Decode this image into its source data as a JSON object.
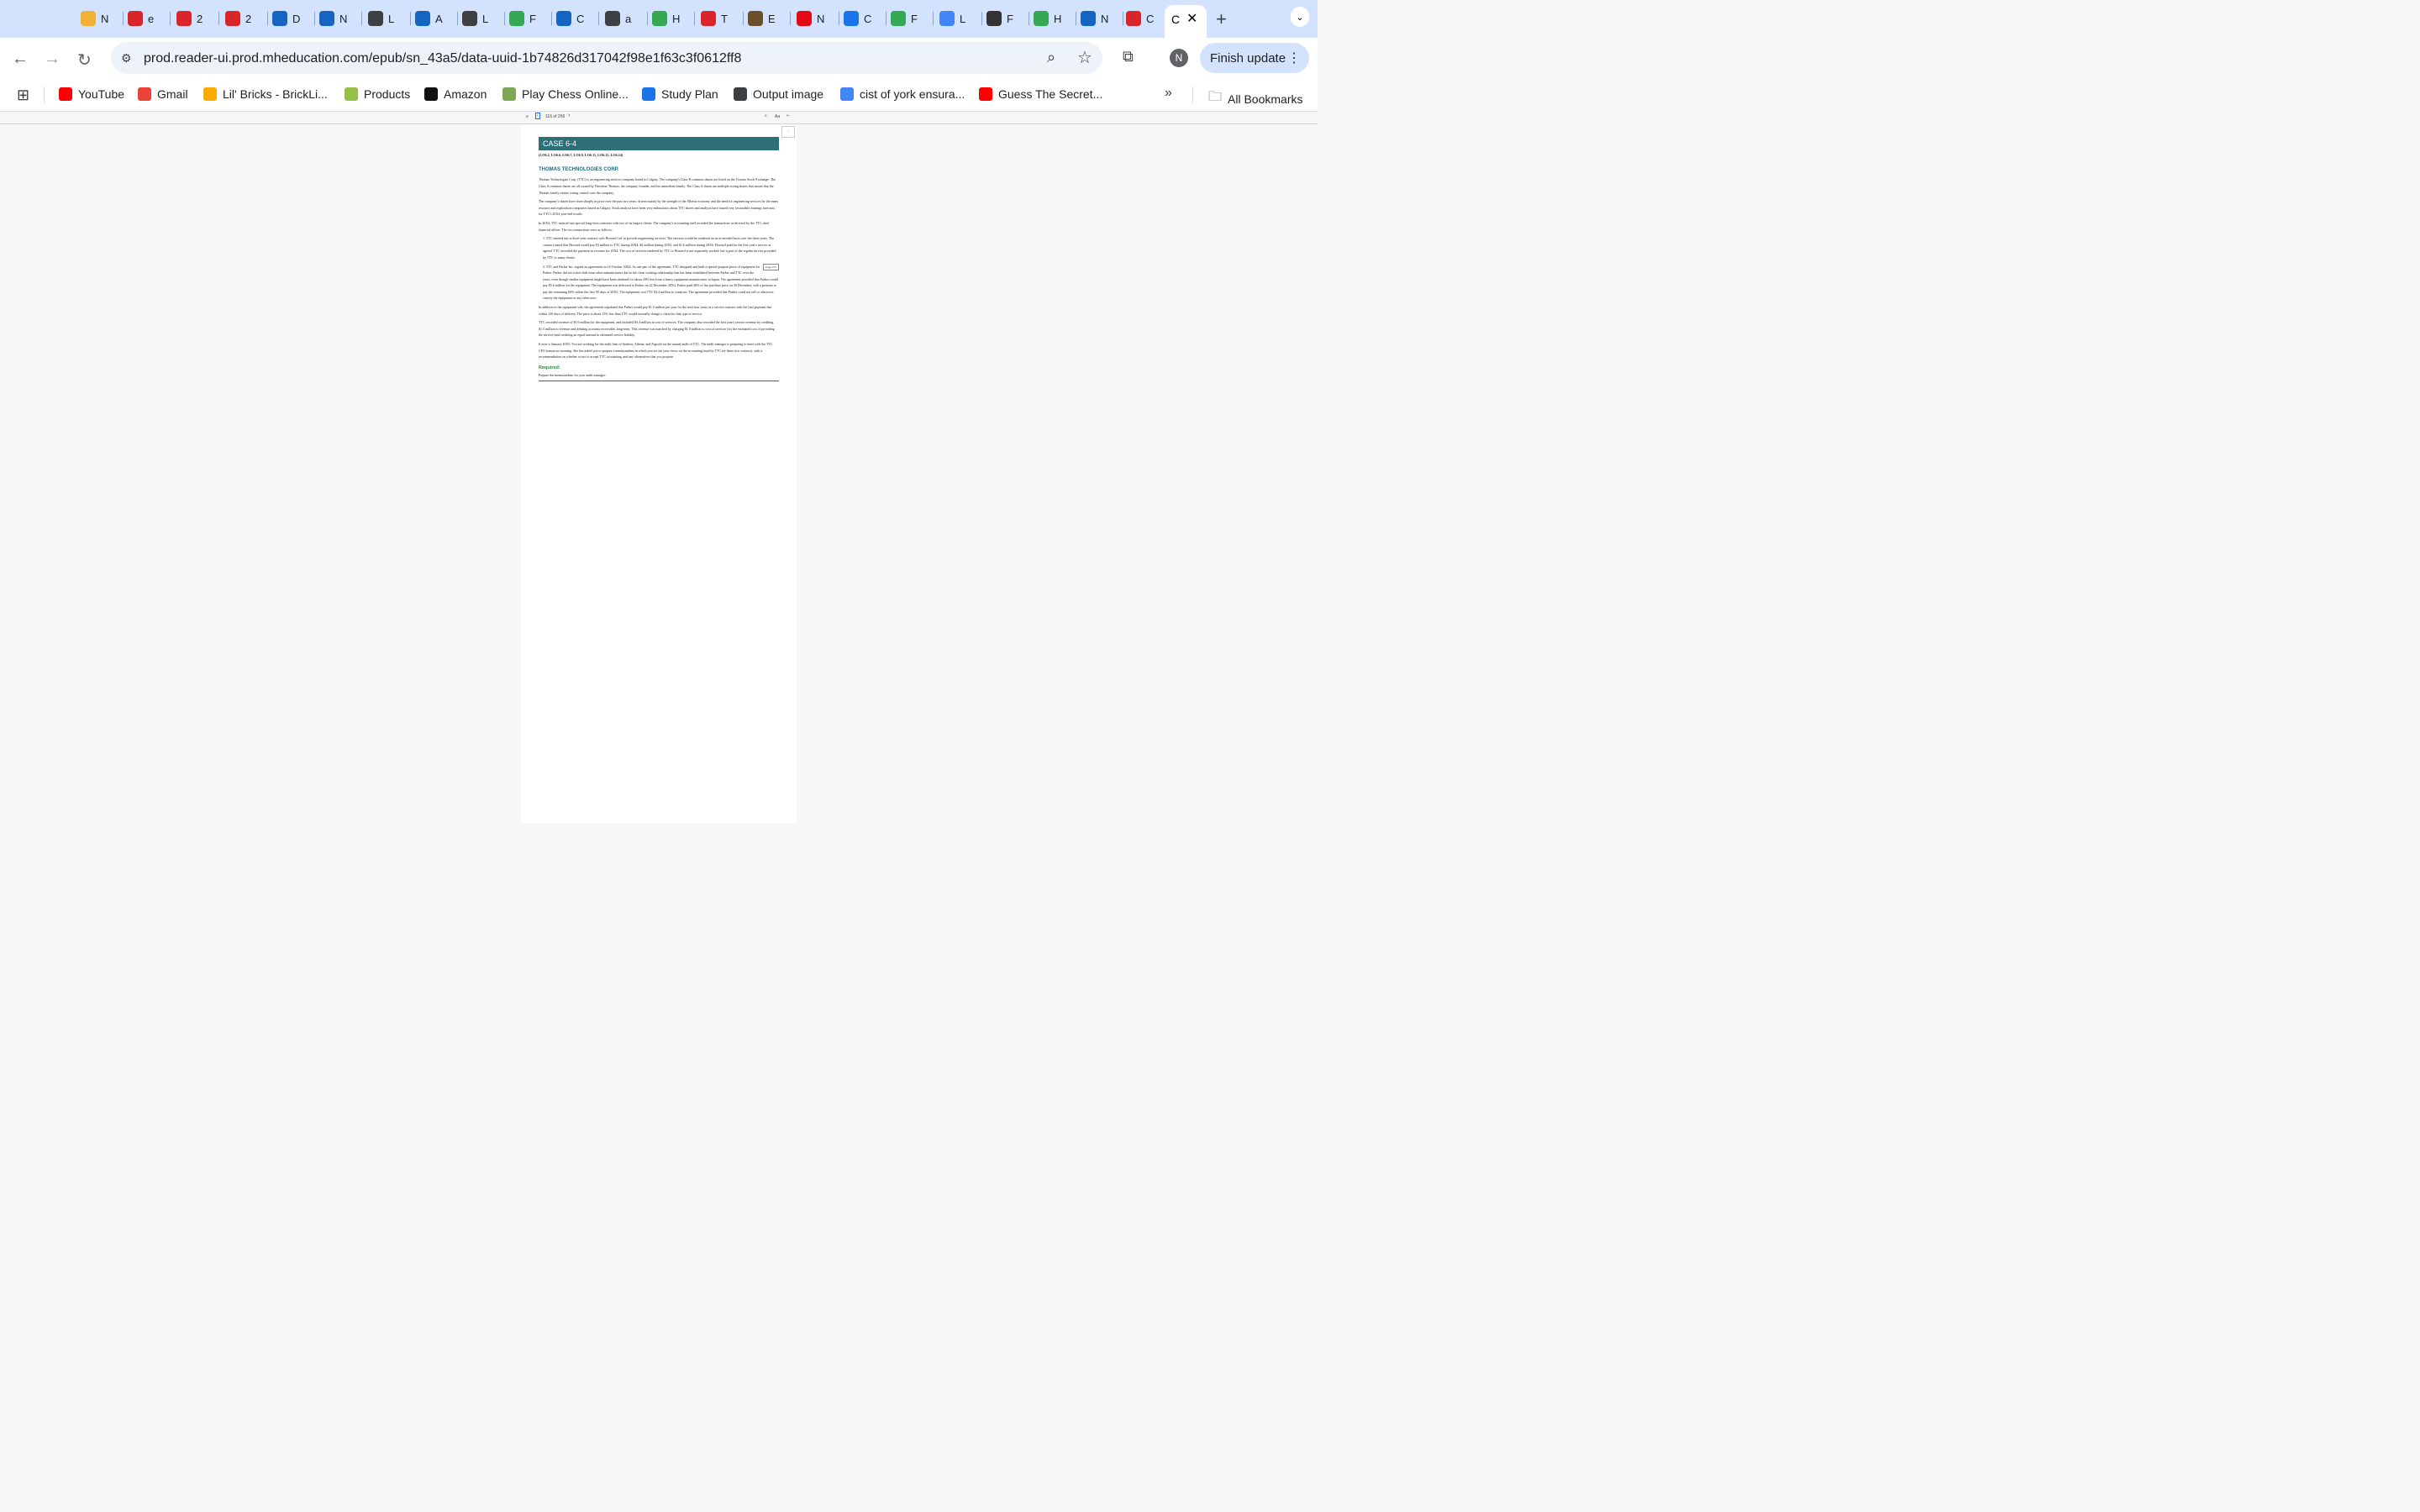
{
  "tabs": [
    {
      "fav": "chart",
      "color": "#f2b134",
      "letter": "N"
    },
    {
      "fav": "u",
      "color": "#d9252a",
      "letter": "e"
    },
    {
      "fav": "u",
      "color": "#d9252a",
      "letter": "2"
    },
    {
      "fav": "u",
      "color": "#d9252a",
      "letter": "2"
    },
    {
      "fav": "s",
      "color": "#1565c0",
      "letter": "D"
    },
    {
      "fav": "s",
      "color": "#1565c0",
      "letter": "N"
    },
    {
      "fav": "globe",
      "color": "#3c4043",
      "letter": "L"
    },
    {
      "fav": "s",
      "color": "#1565c0",
      "letter": "A"
    },
    {
      "fav": "globe",
      "color": "#3c4043",
      "letter": "L"
    },
    {
      "fav": "drive",
      "color": "#34a853",
      "letter": "F"
    },
    {
      "fav": "s",
      "color": "#1565c0",
      "letter": "C"
    },
    {
      "fav": "globe",
      "color": "#3c4043",
      "letter": "a"
    },
    {
      "fav": "drive",
      "color": "#34a853",
      "letter": "H"
    },
    {
      "fav": "mc",
      "color": "#d9252a",
      "letter": "T"
    },
    {
      "fav": "img",
      "color": "#6b4f2a",
      "letter": "E"
    },
    {
      "fav": "n",
      "color": "#e50914",
      "letter": "N"
    },
    {
      "fav": "atp",
      "color": "#1a73e8",
      "letter": "C"
    },
    {
      "fav": "drive",
      "color": "#34a853",
      "letter": "F"
    },
    {
      "fav": "doc",
      "color": "#4285f4",
      "letter": "L"
    },
    {
      "fav": "ai",
      "color": "#333333",
      "letter": "F"
    },
    {
      "fav": "drive",
      "color": "#34a853",
      "letter": "H"
    },
    {
      "fav": "s",
      "color": "#1565c0",
      "letter": "N"
    },
    {
      "fav": "mc",
      "color": "#d9252a",
      "letter": "C"
    }
  ],
  "active_tab_letter": "C",
  "url": "prod.reader-ui.prod.mheducation.com/epub/sn_43a5/data-uuid-1b74826d317042f98e1f63c3f0612ff8",
  "avatar_letter": "N",
  "finish_update": "Finish update",
  "bookmarks": [
    {
      "label": "YouTube",
      "icon": "youtube",
      "color": "#ff0000"
    },
    {
      "label": "Gmail",
      "icon": "gmail",
      "color": "#ea4335"
    },
    {
      "label": "Lil' Bricks - BrickLi...",
      "icon": "bricks",
      "color": "#f9ab00"
    },
    {
      "label": "Products",
      "icon": "shopify",
      "color": "#95bf47"
    },
    {
      "label": "Amazon",
      "icon": "amazon",
      "color": "#111111"
    },
    {
      "label": "Play Chess Online...",
      "icon": "chess",
      "color": "#7fa650"
    },
    {
      "label": "Study Plan",
      "icon": "p",
      "color": "#1a73e8"
    },
    {
      "label": "Output image",
      "icon": "globe",
      "color": "#3c4043"
    },
    {
      "label": "cist of york ensura...",
      "icon": "google",
      "color": "#4285f4"
    },
    {
      "label": "Guess The Secret...",
      "icon": "youtube",
      "color": "#ff0000"
    }
  ],
  "all_bookmarks": "All Bookmarks",
  "reader": {
    "page_counter": "116 of 266",
    "font_button": "Aa"
  },
  "doc": {
    "case": "CASE 6-4",
    "los": "(LO6.2, LO6.6, LO6.7, LO6.9, LO6.11, LO6.12, LO6.14)",
    "company": "THOMAS TECHNOLOGIES CORP.",
    "p1": "Thomas Technologies Corp. (TTC) is an engineering services company based in Calgary. The company's Class B common shares are listed on the Toronto Stock Exchange. The Class A common shares are all owned by Theodore Thomas, the company founder, and his immediate family. The Class A shares are multiple voting shares that assure that the Thomas family retains voting control over the company.",
    "p2": "The company's shares have risen sharply in price over the past two years, driven mainly by the strength of the Alberta economy and the need for engineering services by the many resource and exploration companies based in Calgary. Stock analysts have been very enthusiastic about TTC shares and analysts have issued very favourable earnings forecasts for TTC's 20X4 year-end results.",
    "p3": "In 20X4, TTC entered into special long-term contracts with two of its largest clients. The company's accounting staff recorded the transactions as directed by the TTC chief financial officer. The two transactions were as follows:",
    "item1": "1. TTC entered into a three-year contract with Howard Ltd. to provide engineering services. The services would be rendered on an as-needed basis over the three years. The contract stated that Howard would pay $3 million to TTC during 20X4, $2 million during 20X5, and $1.6 million during 20X6. Howard paid for the first year's service as agreed. TTC recorded the payment as revenue for 20X4. The cost of services rendered by TTC to Howard is not separately tracked, but is part of the regular service provided by TTC to many clients.",
    "page_ref": "Page 377",
    "item2": "2. TTC and Parker Inc. signed an agreement on 14 October 20X4. As one part of the agreement, TTC designed and built a special-purpose piece of equipment for Parker. Parker did not solicit bids from other manufacturers due to the close working relationship that has been established between Parker and TTC over the years, even though similar equipment might have been obtained for about 20% less from a heavy equipment manufacturer in Japan. The agreement provided that Parker would pay $5.6 million for the equipment. The equipment was delivered to Parker on 22 December 20X4. Parker paid 40% of the purchase price on 30 December, with a promise to pay the remaining 60% within the first 90 days of 20X5. The equipment cost TTC $3.4 million to construct. The agreement provided that Parker could not sell or otherwise convey the equipment to any other user.",
    "p4": "In addition to the equipment sale, the agreement stipulated that Parker would pay $1.5 million per year for the next four years as a service contract with the first payment due within 120 days of delivery. The price is about 25% less than TTC would normally charge a client for that type of service.",
    "p5": "TTC recorded revenue of $5.6 million for the equipment, and included $3.4 million in cost of services. The company also recorded the first year's service revenue by crediting $1.5 million to revenue and debiting accounts receivable–long-term. This revenue was matched by charging $1.0 million to cost of services (for the estimated cost of providing the service) and crediting an equal amount to estimated service liability.",
    "p6": "It now is January 20X5. You are working for the audit firm of Andrew, Athena, and Argoyle on the annual audit of TTC. The audit manager is preparing to meet with the TTC CFO tomorrow morning. She has asked you to prepare a memorandum in which you set out your views on the accounting used by TTC for these two contracts, with a recommendation on whether or not to accept TTC accounting, and any alternatives that you propose.",
    "required": "Required:",
    "task": "Prepare the memorandum for your audit manager."
  }
}
